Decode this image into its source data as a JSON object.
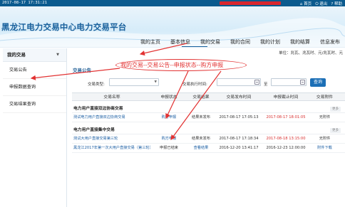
{
  "topbar": {
    "time": "2017-08-17 17:31:21",
    "links": [
      "首页",
      "退出",
      "帮助"
    ],
    "icon_names": [
      "home-icon",
      "logout-icon",
      "help-icon"
    ]
  },
  "header": {
    "title": "黑龙江电力交易中心电力交易平台",
    "nav": [
      "我的主页",
      "基本信息",
      "我的交易",
      "我的合同",
      "我的计划",
      "我的结算",
      "信息发布"
    ],
    "active_nav": "我的交易"
  },
  "sidebar": {
    "heading": "我的交易",
    "items": [
      "交易公告",
      "申报数据查询",
      "交易结果查询"
    ]
  },
  "main": {
    "units": "单位：兆瓦、兆瓦时、元/兆瓦时、元",
    "section_title": "交易公告",
    "annotation": "我的交易--交易公告--申报状态--购方申报",
    "filter": {
      "type_label": "交易类型:",
      "type_value": "",
      "date_label": "交易执行时间:",
      "to_label": "至",
      "search_label": "查询"
    },
    "table": {
      "headers": [
        "交易名称",
        "申报状态",
        "交易结果",
        "交易发布时间",
        "申报截止时间",
        "交易附件"
      ],
      "groups": [
        {
          "name": "电力用户直接双边协商交易",
          "more": "更多",
          "rows": [
            {
              "name": "测试电力用户直接双边协商交易",
              "status": "购方申报",
              "result": "结果未发布",
              "publish": "2017-08-17 17:05:13",
              "deadline": "2017-08-17 18:01:05",
              "attach": "无附件"
            }
          ]
        },
        {
          "name": "电力用户直接集中交易",
          "more": "更多",
          "rows": [
            {
              "name": "测试大用户直接交易第三轮",
              "status": "购方申报",
              "result": "结果未发布",
              "publish": "2017-08-17 17:18:34",
              "deadline": "2017-08-18 13:15:00",
              "attach": "无附件"
            },
            {
              "name": "黑龙江2017年第一次大用户直接交易（第三轮）",
              "status": "申报已结束",
              "result": "查看结果",
              "publish": "2016-12-20 13:41:17",
              "deadline": "2016-12-23 12:00:00",
              "attach": "附件下载"
            }
          ]
        }
      ]
    }
  },
  "colors": {
    "topbar": "#0a5a8e",
    "brand": "#18609c",
    "annotation": "#e23232",
    "button": "#1c6fb6",
    "link": "#1c5fa4"
  }
}
